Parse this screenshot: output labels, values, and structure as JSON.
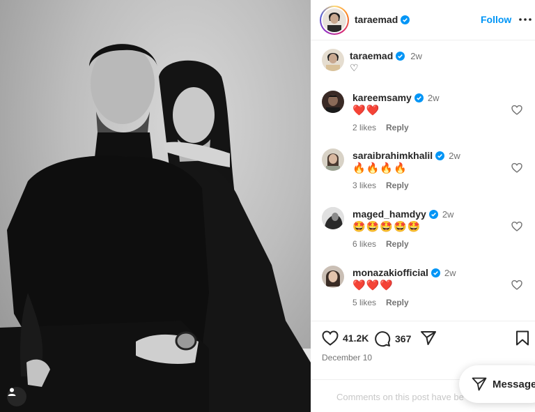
{
  "post": {
    "author": "taraemad",
    "follow_label": "Follow",
    "caption": {
      "author": "taraemad",
      "time": "2w",
      "text": "♡"
    },
    "likes": "41.2K",
    "comments_count": "367",
    "date": "December 10",
    "comments_limited_text": "Comments on this post have be"
  },
  "comments": [
    {
      "user": "kareemsamy",
      "time": "2w",
      "text": "❤️❤️",
      "likes": "2 likes",
      "reply": "Reply"
    },
    {
      "user": "saraibrahimkhalil",
      "time": "2w",
      "text": "🔥🔥🔥🔥",
      "likes": "3 likes",
      "reply": "Reply"
    },
    {
      "user": "maged_hamdyy",
      "time": "2w",
      "text": "🤩🤩🤩🤩🤩",
      "likes": "6 likes",
      "reply": "Reply"
    },
    {
      "user": "monazakiofficial",
      "time": "2w",
      "text": "❤️❤️❤️",
      "likes": "5 likes",
      "reply": "Reply"
    }
  ],
  "messages_label": "Messages",
  "icons": [
    "verified-badge-icon",
    "more-icon",
    "heart-icon",
    "comment-icon",
    "share-icon",
    "bookmark-icon",
    "send-icon",
    "user-tag-icon"
  ],
  "colors": {
    "accent": "#0095f6",
    "verified": "#0095f6",
    "text": "#262626",
    "muted": "#737373"
  }
}
